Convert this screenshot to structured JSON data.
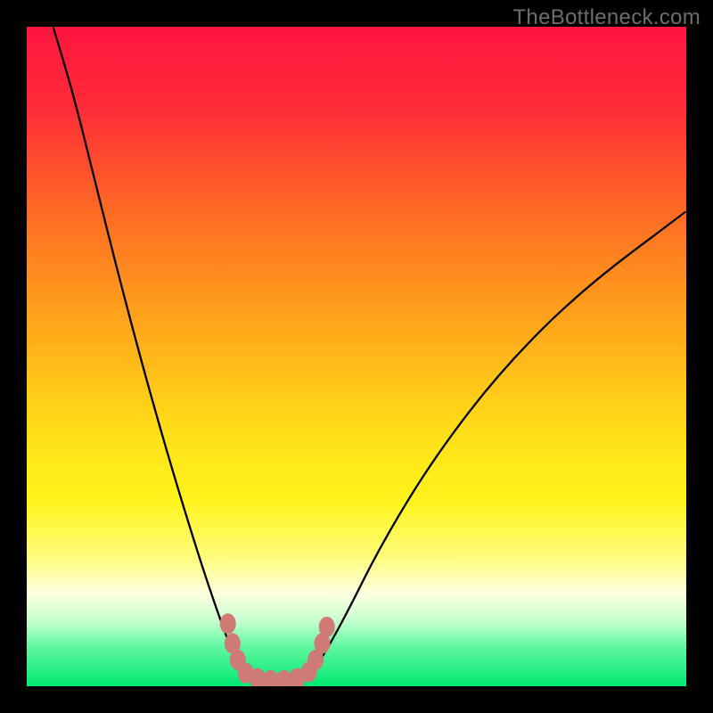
{
  "watermark": "TheBottleneck.com",
  "chart_data": {
    "type": "line",
    "title": "",
    "xlabel": "",
    "ylabel": "",
    "xlim": [
      0,
      100
    ],
    "ylim": [
      0,
      100
    ],
    "grid": false,
    "background": {
      "type": "vertical-gradient",
      "stops": [
        {
          "offset": 0.0,
          "color": "#ff153f"
        },
        {
          "offset": 0.12,
          "color": "#ff2b38"
        },
        {
          "offset": 0.28,
          "color": "#ff6a25"
        },
        {
          "offset": 0.45,
          "color": "#ffa61a"
        },
        {
          "offset": 0.62,
          "color": "#ffe018"
        },
        {
          "offset": 0.72,
          "color": "#fff41d"
        },
        {
          "offset": 0.8,
          "color": "#fffc76"
        },
        {
          "offset": 0.86,
          "color": "#fcffdf"
        },
        {
          "offset": 0.9,
          "color": "#c7ffd0"
        },
        {
          "offset": 0.94,
          "color": "#61f8a1"
        },
        {
          "offset": 1.0,
          "color": "#00e770"
        }
      ]
    },
    "min_region": {
      "x_start": 32,
      "x_end": 44,
      "y": 0
    },
    "series": [
      {
        "name": "left-curve",
        "points": [
          {
            "x": 4,
            "y": 100
          },
          {
            "x": 7,
            "y": 90
          },
          {
            "x": 10,
            "y": 78
          },
          {
            "x": 14,
            "y": 62
          },
          {
            "x": 18,
            "y": 47
          },
          {
            "x": 22,
            "y": 33
          },
          {
            "x": 26,
            "y": 20
          },
          {
            "x": 29,
            "y": 11
          },
          {
            "x": 32,
            "y": 3
          },
          {
            "x": 34,
            "y": 1
          },
          {
            "x": 38,
            "y": 0.5
          }
        ]
      },
      {
        "name": "right-curve",
        "points": [
          {
            "x": 38,
            "y": 0.5
          },
          {
            "x": 42,
            "y": 1
          },
          {
            "x": 44,
            "y": 3
          },
          {
            "x": 48,
            "y": 10
          },
          {
            "x": 54,
            "y": 22
          },
          {
            "x": 62,
            "y": 35
          },
          {
            "x": 72,
            "y": 48
          },
          {
            "x": 84,
            "y": 60
          },
          {
            "x": 100,
            "y": 72
          }
        ]
      },
      {
        "name": "bottom-dotted-markers",
        "points": [
          {
            "x": 30.5,
            "y": 9.5
          },
          {
            "x": 31.2,
            "y": 6.5
          },
          {
            "x": 32.0,
            "y": 4.0
          },
          {
            "x": 33.2,
            "y": 2.0
          },
          {
            "x": 35.0,
            "y": 1.2
          },
          {
            "x": 37.0,
            "y": 0.9
          },
          {
            "x": 39.0,
            "y": 0.9
          },
          {
            "x": 41.0,
            "y": 1.2
          },
          {
            "x": 42.8,
            "y": 2.2
          },
          {
            "x": 43.8,
            "y": 4.0
          },
          {
            "x": 44.8,
            "y": 6.5
          },
          {
            "x": 45.5,
            "y": 9.0
          }
        ]
      }
    ]
  }
}
